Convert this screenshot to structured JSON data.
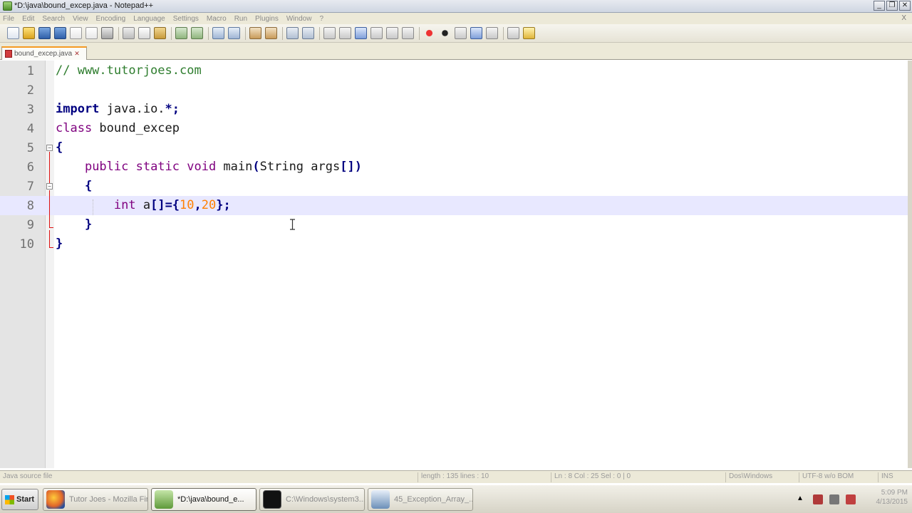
{
  "window": {
    "title": "*D:\\java\\bound_excep.java - Notepad++",
    "min_label": "_",
    "restore_label": "❐",
    "close_label": "✕"
  },
  "menu": {
    "items": [
      "File",
      "Edit",
      "Search",
      "View",
      "Encoding",
      "Language",
      "Settings",
      "Macro",
      "Run",
      "Plugins",
      "Window",
      "?"
    ],
    "close_label": "X"
  },
  "tab": {
    "label": "bound_excep.java",
    "close_label": "✕"
  },
  "editor": {
    "lines": [
      {
        "num": "1",
        "tokens": [
          {
            "t": "// www.tutorjoes.com",
            "c": "comment"
          }
        ]
      },
      {
        "num": "2",
        "tokens": []
      },
      {
        "num": "3",
        "tokens": [
          {
            "t": "import",
            "c": "kw"
          },
          {
            "t": " java.io.",
            "c": ""
          },
          {
            "t": "*;",
            "c": "op"
          }
        ]
      },
      {
        "num": "4",
        "tokens": [
          {
            "t": "class",
            "c": "type"
          },
          {
            "t": " bound_excep",
            "c": ""
          }
        ]
      },
      {
        "num": "5",
        "tokens": [
          {
            "t": "{",
            "c": "op"
          }
        ]
      },
      {
        "num": "6",
        "tokens": [
          {
            "t": "    ",
            "c": ""
          },
          {
            "t": "public static void",
            "c": "type"
          },
          {
            "t": " main",
            "c": ""
          },
          {
            "t": "(",
            "c": "op"
          },
          {
            "t": "String args",
            "c": ""
          },
          {
            "t": "[])",
            "c": "op"
          }
        ]
      },
      {
        "num": "7",
        "tokens": [
          {
            "t": "    ",
            "c": ""
          },
          {
            "t": "{",
            "c": "op"
          }
        ]
      },
      {
        "num": "8",
        "tokens": [
          {
            "t": "        ",
            "c": ""
          },
          {
            "t": "int",
            "c": "type"
          },
          {
            "t": " a",
            "c": ""
          },
          {
            "t": "[]={",
            "c": "op"
          },
          {
            "t": "10",
            "c": "num"
          },
          {
            "t": ",",
            "c": "op"
          },
          {
            "t": "20",
            "c": "num"
          },
          {
            "t": "};",
            "c": "op"
          }
        ]
      },
      {
        "num": "9",
        "tokens": [
          {
            "t": "    ",
            "c": ""
          },
          {
            "t": "}",
            "c": "op"
          }
        ]
      },
      {
        "num": "10",
        "tokens": [
          {
            "t": "}",
            "c": "op"
          }
        ]
      }
    ],
    "current_line": 8
  },
  "status": {
    "file_type": "Java source file",
    "length": "length : 135    lines : 10",
    "position": "Ln : 8    Col : 25    Sel : 0 | 0",
    "eol": "Dos\\Windows",
    "encoding": "UTF-8 w/o BOM",
    "mode": "INS"
  },
  "taskbar": {
    "start_label": "Start",
    "tasks": [
      {
        "label": "Tutor Joes - Mozilla Fir...",
        "color": "#e0662a"
      },
      {
        "label": "*D:\\java\\bound_e...",
        "color": "#7cb25a",
        "active": true
      },
      {
        "label": "C:\\Windows\\system3...",
        "color": "#111111"
      },
      {
        "label": "45_Exception_Array_...",
        "color": "#6b8fb8"
      }
    ],
    "clock_time": "5:09 PM",
    "clock_date": "4/13/2015"
  },
  "colors": {
    "comment": "#2e7d2e",
    "keyword": "#000080",
    "type": "#7f007f",
    "number": "#ff8000",
    "current_line": "#e8e8ff",
    "tab_accent": "#f59a23"
  }
}
